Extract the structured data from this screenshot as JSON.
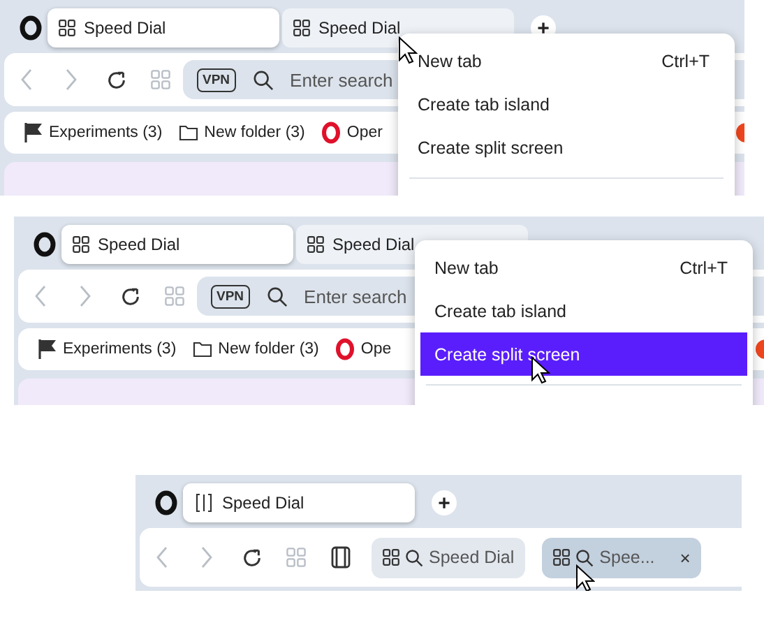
{
  "screenshots": [
    {
      "kind": "menu",
      "tabs": [
        {
          "label": "Speed Dial",
          "selected": true
        },
        {
          "label": "Speed Dial",
          "selected": false
        }
      ],
      "new_tab_button": "+",
      "vpn_badge": "VPN",
      "address_placeholder": "Enter search",
      "bookmarks": [
        {
          "kind": "flag",
          "label": "Experiments (3)"
        },
        {
          "kind": "folder",
          "label": "New folder (3)"
        },
        {
          "kind": "opera",
          "label": "Oper"
        }
      ],
      "menu": [
        {
          "label": "New tab",
          "shortcut": "Ctrl+T",
          "selected": false
        },
        {
          "label": "Create tab island",
          "selected": false
        },
        {
          "label": "Create split screen",
          "selected": false
        }
      ]
    },
    {
      "kind": "menu",
      "tabs": [
        {
          "label": "Speed Dial",
          "selected": true
        },
        {
          "label": "Speed Dial",
          "selected": false
        }
      ],
      "vpn_badge": "VPN",
      "address_placeholder": "Enter search",
      "bookmarks": [
        {
          "kind": "flag",
          "label": "Experiments (3)"
        },
        {
          "kind": "folder",
          "label": "New folder (3)"
        },
        {
          "kind": "opera",
          "label": "Ope"
        }
      ],
      "menu": [
        {
          "label": "New tab",
          "shortcut": "Ctrl+T",
          "selected": false
        },
        {
          "label": "Create tab island",
          "selected": false
        },
        {
          "label": "Create split screen",
          "selected": true
        }
      ]
    },
    {
      "kind": "split",
      "tabs": [
        {
          "label": "Speed Dial",
          "selected": true
        }
      ],
      "new_tab_button": "+",
      "split_tabs": [
        {
          "label": "Speed Dial",
          "selected": false
        },
        {
          "label": "Spee...",
          "selected": true,
          "close": "×"
        }
      ]
    }
  ]
}
